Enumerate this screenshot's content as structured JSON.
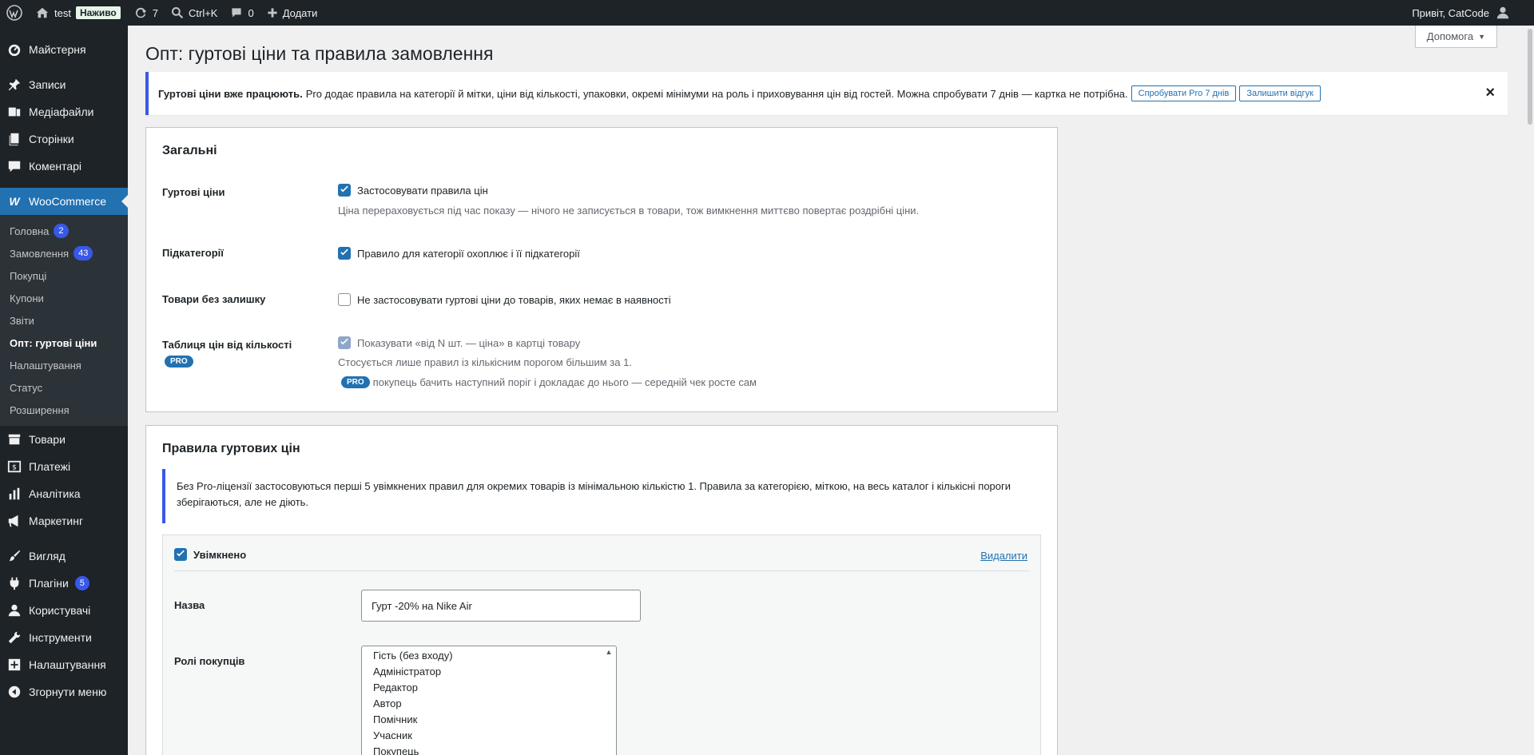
{
  "adminbar": {
    "site_name": "test",
    "live_label": "Наживо",
    "updates_count": "7",
    "search_shortcut": "Ctrl+K",
    "comments_count": "0",
    "add_label": "Додати",
    "greeting": "Привіт, CatCode"
  },
  "sidebar": {
    "dashboard": "Майстерня",
    "posts": "Записи",
    "media": "Медіафайли",
    "pages": "Сторінки",
    "comments": "Коментарі",
    "woocommerce": "WooCommerce",
    "submenu": {
      "home": "Головна",
      "home_count": "2",
      "orders": "Замовлення",
      "orders_count": "43",
      "customers": "Покупці",
      "coupons": "Купони",
      "reports": "Звіти",
      "wholesale": "Опт: гуртові ціни",
      "settings": "Налаштування",
      "status": "Статус",
      "extensions": "Розширення"
    },
    "products": "Товари",
    "payments": "Платежі",
    "analytics": "Аналітика",
    "marketing": "Маркетинг",
    "appearance": "Вигляд",
    "plugins": "Плагіни",
    "plugins_count": "5",
    "users": "Користувачі",
    "tools": "Інструменти",
    "settings": "Налаштування",
    "collapse": "Згорнути меню"
  },
  "page": {
    "title": "Опт: гуртові ціни та правила замовлення",
    "help_label": "Допомога"
  },
  "notice": {
    "strong": "Гуртові ціни вже працюють.",
    "text": "Pro додає правила на категорії й мітки, ціни від кількості, упаковки, окремі мінімуми на роль і приховування цін від гостей. Можна спробувати 7 днів — картка не потрібна.",
    "try_pro": "Спробувати Pro 7 днів",
    "feedback": "Залишити відгук",
    "close": "×"
  },
  "general": {
    "title": "Загальні",
    "wholesale_label": "Гуртові ціни",
    "wholesale_cb": "Застосовувати правила цін",
    "wholesale_desc": "Ціна перераховується під час показу — нічого не записується в товари, тож вимкнення миттєво повертає роздрібні ціни.",
    "subcat_label": "Підкатегорії",
    "subcat_cb": "Правило для категорії охоплює і її підкатегорії",
    "nostock_label": "Товари без залишку",
    "nostock_cb": "Не застосовувати гуртові ціни до товарів, яких немає в наявності",
    "table_label": "Таблиця цін від кількості",
    "pro_badge": "PRO",
    "table_cb": "Показувати «від N шт. — ціна» в картці товару",
    "table_desc": "Стосується лише правил із кількісним порогом більшим за 1.",
    "table_pro_desc": "покупець бачить наступний поріг і докладає до нього — середній чек росте сам"
  },
  "rules": {
    "title": "Правила гуртових цін",
    "info": "Без Pro-ліцензії застосовуються перші 5 увімкнених правил для окремих товарів із мінімальною кількістю 1. Правила за категорією, міткою, на весь каталог і кількісні пороги зберігаються, але не діють.",
    "enabled": "Увімкнено",
    "delete": "Видалити",
    "name_label": "Назва",
    "name_value": "Гурт -20% на Nike Air",
    "roles_label": "Ролі покупців",
    "roles": [
      "Гість (без входу)",
      "Адміністратор",
      "Редактор",
      "Автор",
      "Помічник",
      "Учасник",
      "Покупець"
    ]
  }
}
